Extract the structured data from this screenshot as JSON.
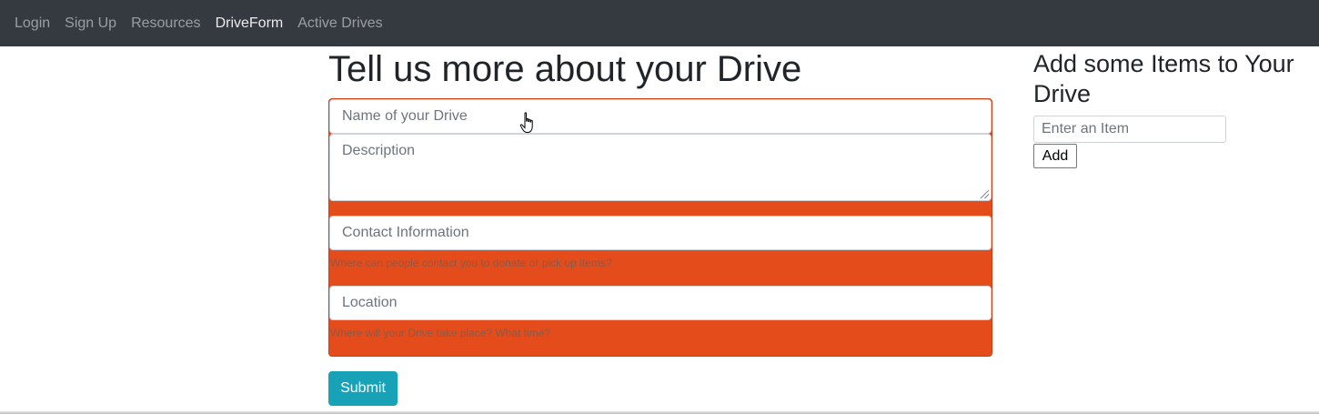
{
  "nav": {
    "items": [
      {
        "label": "Login"
      },
      {
        "label": "Sign Up"
      },
      {
        "label": "Resources"
      },
      {
        "label": "DriveForm"
      },
      {
        "label": "Active Drives"
      }
    ],
    "active": "DriveForm"
  },
  "form": {
    "heading": "Tell us more about your Drive",
    "name_placeholder": "Name of your Drive",
    "description_placeholder": "Description",
    "contact_placeholder": "Contact Information",
    "contact_help": "Where can people contact you to donate or pick up items?",
    "location_placeholder": "Location",
    "location_help": "Where will your Drive take place? What time?",
    "submit_label": "Submit"
  },
  "sidebar": {
    "heading": "Add some Items to Your Drive",
    "item_placeholder": "Enter an Item",
    "add_label": "Add"
  },
  "colors": {
    "navbar": "#343a40",
    "form_error_bg": "#e44c1b",
    "submit_bg": "#17a2b8"
  },
  "icons": {
    "cursor": "hand-pointer-icon",
    "resize": "resize-grip-icon"
  }
}
